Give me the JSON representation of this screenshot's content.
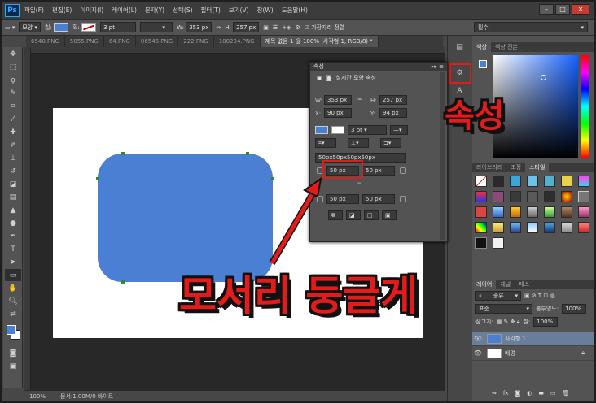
{
  "menu": {
    "logo": "Ps",
    "items": [
      "파일(F)",
      "편집(E)",
      "이미지(I)",
      "레이어(L)",
      "문자(Y)",
      "선택(S)",
      "필터(T)",
      "보기(V)",
      "창(W)",
      "도움말(H)"
    ]
  },
  "window_buttons": [
    "–",
    "□",
    "✕"
  ],
  "options": {
    "mode": "모양",
    "fill_label": "칠:",
    "stroke_label": "획:",
    "stroke_width": "3 pt",
    "w_label": "W:",
    "w_value": "353 px",
    "h_label": "H:",
    "h_value": "257 px",
    "align_edges": "가장자리 정렬",
    "workspace": "필수"
  },
  "tabs": [
    "6540.PNG",
    "5855.PNG",
    "64.PNG",
    "06546.PNG",
    "222.PNG",
    "100234.PNG",
    "제목 없음-1 @ 100% (사각형 1, RGB/8) *"
  ],
  "status": {
    "zoom": "100%",
    "doc": "문서:1.00M/0 바이트"
  },
  "properties": {
    "header": "속성",
    "title": "실시간 모양 속성",
    "w_label": "W:",
    "w": "353 px",
    "h_label": "H:",
    "h": "257 px",
    "x_label": "X:",
    "x": "90 px",
    "y_label": "Y:",
    "y": "94 px",
    "stroke": "3 pt",
    "radius_all": "50px50px50px50px",
    "r_tl": "50 px",
    "r_tr": "50 px",
    "r_bl": "50 px",
    "r_br": "50 px"
  },
  "panels": {
    "color_tabs": [
      "색상",
      "색상 견본"
    ],
    "lib_tabs": [
      "라이브러리",
      "조정",
      "스타일"
    ],
    "layer_tabs": [
      "레이어",
      "채널",
      "패스"
    ],
    "layer_kind": "종류",
    "blend_mode": "표준",
    "opacity_label": "불투명도:",
    "opacity": "100%",
    "lock_label": "잠그기:",
    "fill_label": "칠:",
    "fill": "100%",
    "layers": [
      {
        "name": "사각형 1",
        "selected": true
      },
      {
        "name": "배경",
        "selected": false
      }
    ]
  },
  "annotations": {
    "properties_callout": "속성",
    "rounded_corners_callout": "모서리 둥글게"
  },
  "colors": {
    "shape_fill": "#4a7fd4",
    "annotation_red": "#e31b1b"
  }
}
